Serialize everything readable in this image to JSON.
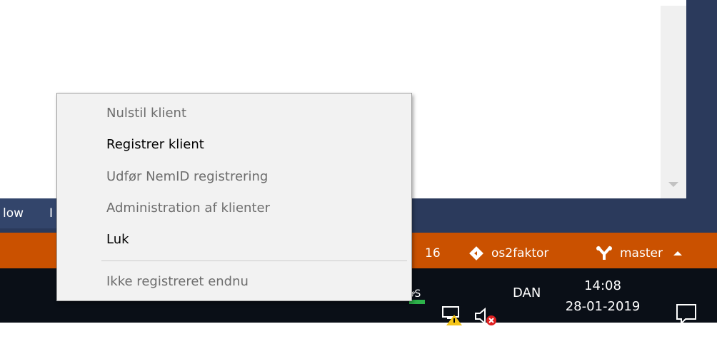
{
  "app_window": {
    "menu_fragments": [
      "low",
      "I"
    ]
  },
  "status_bar": {
    "count": "16",
    "repo_name": "os2faktor",
    "branch_name": "master",
    "repo_icon": "git-diamond-icon",
    "branch_icon": "git-branch-icon",
    "expand_icon": "triangle-up-icon"
  },
  "context_menu": {
    "items": [
      {
        "label": "Nulstil klient",
        "enabled": false
      },
      {
        "label": "Registrer klient",
        "enabled": true
      },
      {
        "label": "Udfør NemID registrering",
        "enabled": false
      },
      {
        "label": "Administration af klienter",
        "enabled": false
      },
      {
        "label": "Luk",
        "enabled": true
      }
    ],
    "status_text": "Ikke registreret endnu"
  },
  "taskbar": {
    "language": "DAN",
    "time": "14:08",
    "date": "28-01-2019",
    "tray_icons": [
      "os2faktor-icon",
      "network-warning-icon",
      "volume-muted-icon",
      "notification-icon"
    ]
  },
  "colors": {
    "status_bar": "#ca5100",
    "window_frame": "#2b3a5c",
    "taskbar": "#0a0f17",
    "menu_background": "#f2f2f2"
  }
}
